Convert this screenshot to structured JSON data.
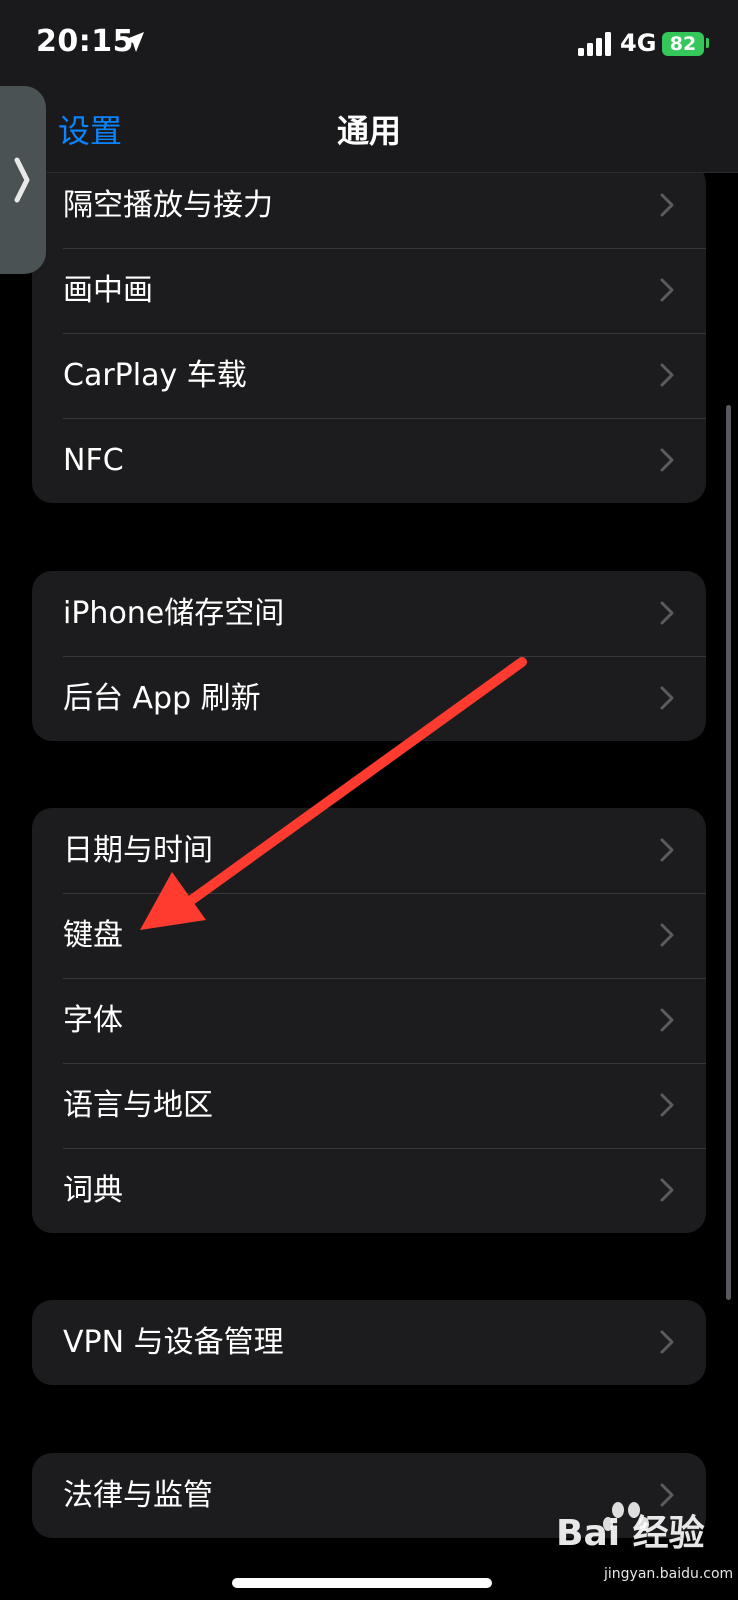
{
  "status_bar": {
    "time": "20:15",
    "network": "4G",
    "battery": "82"
  },
  "nav": {
    "back_label": "设置",
    "title": "通用"
  },
  "groups": [
    {
      "items": [
        "隔空播放与接力",
        "画中画",
        "CarPlay 车载",
        "NFC"
      ]
    },
    {
      "items": [
        "iPhone储存空间",
        "后台 App 刷新"
      ]
    },
    {
      "items": [
        "日期与时间",
        "键盘",
        "字体",
        "语言与地区",
        "词典"
      ]
    },
    {
      "items": [
        "VPN 与设备管理"
      ]
    },
    {
      "items": [
        "法律与监管"
      ]
    }
  ],
  "watermark": {
    "text": "Bai 经验",
    "sub": "jingyan.baidu.com"
  },
  "colors": {
    "accent": "#0a84ff",
    "battery": "#34c759",
    "annotation_arrow": "#ff3b30"
  }
}
